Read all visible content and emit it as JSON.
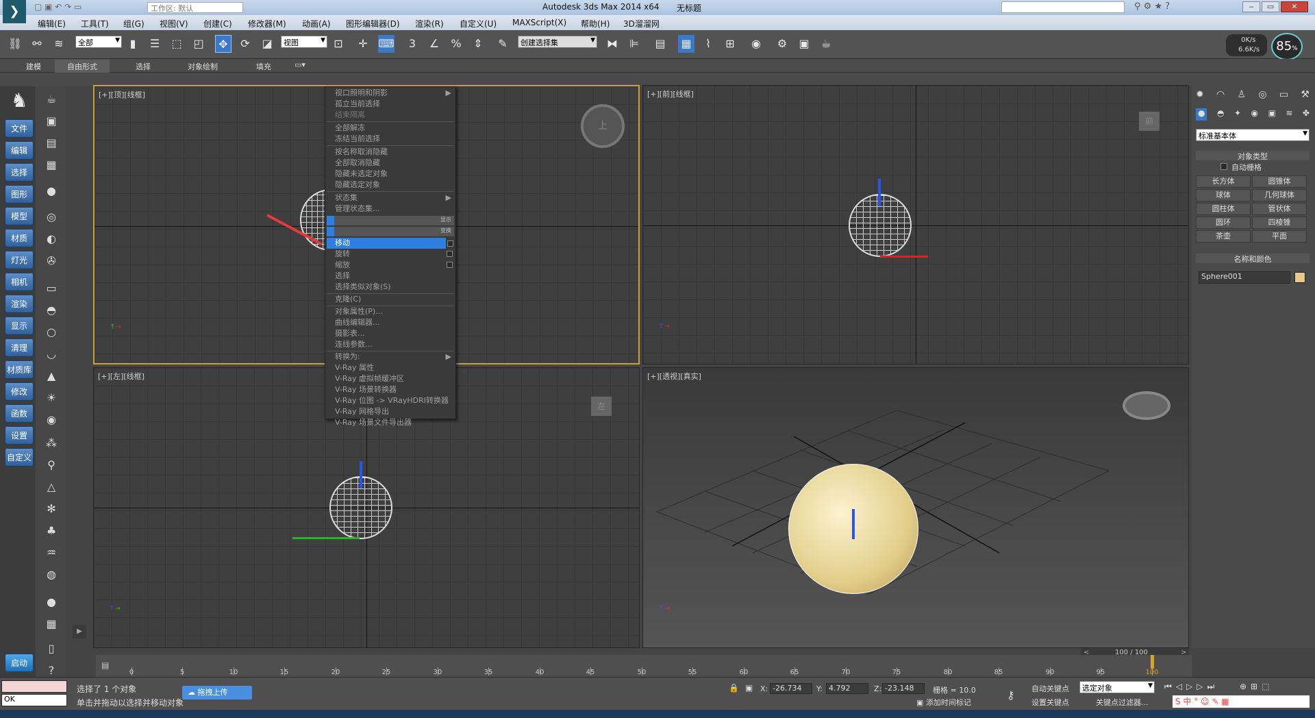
{
  "title": {
    "app": "Autodesk 3ds Max  2014 x64",
    "doc": "无标题",
    "workspace": "工作区: 默认"
  },
  "menu": [
    "编辑(E)",
    "工具(T)",
    "组(G)",
    "视图(V)",
    "创建(C)",
    "修改器(M)",
    "动画(A)",
    "图形编辑器(D)",
    "渲染(R)",
    "自定义(U)",
    "MAXScript(X)",
    "帮助(H)",
    "3D溜溜网"
  ],
  "toolbar": {
    "filter": "全部",
    "refcoord": "视图",
    "selset": "创建选择集",
    "snap_num": "3",
    "net_up": "0K/s",
    "net_down": "6.6K/s",
    "cpu": "85"
  },
  "ribbon": [
    "建模",
    "自由形式",
    "选择",
    "对象绘制",
    "填充"
  ],
  "left_buttons": [
    "文件",
    "编辑",
    "选择",
    "图形",
    "模型",
    "材质",
    "灯光",
    "相机",
    "渲染",
    "显示",
    "清理",
    "材质库",
    "修改",
    "函数",
    "设置",
    "自定义"
  ],
  "left_start": "启动",
  "viewports": {
    "top": {
      "label": "[+][顶][线框]",
      "cube": "上"
    },
    "front": {
      "label": "[+][前][线框]",
      "cube": "前"
    },
    "left": {
      "label": "[+][左][线框]",
      "cube": "左"
    },
    "persp": {
      "label": "[+][透视][真实]"
    }
  },
  "context_menu": {
    "items": [
      "视口照明和阴影",
      "孤立当前选择",
      "结束隔离",
      "全部解冻",
      "冻结当前选择",
      "按名称取消隐藏",
      "全部取消隐藏",
      "隐藏未选定对象",
      "隐藏选定对象",
      "状态集",
      "管理状态集..."
    ],
    "quad_display": "显示",
    "quad_transform": "变换",
    "transform": [
      "移动",
      "旋转",
      "缩放",
      "选择",
      "选择类似对象(S)",
      "克隆(C)",
      "对象属性(P)...",
      "曲线编辑器...",
      "摄影表...",
      "连线参数...",
      "转换为:",
      "V-Ray 属性",
      "V-Ray 虚拟帧缓冲区",
      "V-Ray 场景转换器",
      "V-Ray 位图 -> VRayHDRI转换器",
      "V-Ray 网格导出",
      "V-Ray 场景文件导出器"
    ],
    "highlighted": "移动"
  },
  "command_panel": {
    "category": "标准基本体",
    "rollout_type": "对象类型",
    "autogrid": "自动栅格",
    "objects": [
      "长方体",
      "圆锥体",
      "球体",
      "几何球体",
      "圆柱体",
      "管状体",
      "圆环",
      "四棱锥",
      "茶壶",
      "平面"
    ],
    "rollout_name": "名称和颜色",
    "object_name": "Sphere001",
    "object_color": "#e8c98a"
  },
  "timeline": {
    "frame": "100 / 100",
    "ticks": [
      "0",
      "5",
      "10",
      "15",
      "20",
      "25",
      "30",
      "35",
      "40",
      "45",
      "50",
      "55",
      "60",
      "65",
      "70",
      "75",
      "80",
      "85",
      "90",
      "95",
      "100"
    ]
  },
  "status": {
    "selected": "选择了 1 个对象",
    "prompt": "单击并拖动以选择并移动对象",
    "upload": "拖拽上传",
    "x_label": "X:",
    "x": "-26.734",
    "y_label": "Y:",
    "y": "4.792",
    "z_label": "Z:",
    "z": "-23.148",
    "grid": "栅格 = 10.0",
    "autokey": "自动关键点",
    "setkey": "设置关键点",
    "keymode": "选定对象",
    "keyfilter": "关键点过滤器...",
    "addtime": "添加时间标记",
    "mini_ok": "OK"
  }
}
